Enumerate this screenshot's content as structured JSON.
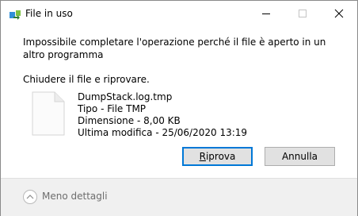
{
  "window": {
    "title": "File in uso",
    "title_icon": "file-transfer-icon",
    "controls": {
      "minimize_icon": "minimize-icon",
      "maximize_icon": "maximize-icon",
      "close_icon": "close-icon"
    }
  },
  "message": {
    "text": "Impossibile completare l'operazione perché il file è aperto in un altro programma",
    "instruction": "Chiudere il file e riprovare."
  },
  "file": {
    "icon": "generic-file-icon",
    "name": "DumpStack.log.tmp",
    "type": "Tipo - File TMP",
    "size": "Dimensione - 8,00 KB",
    "modified": "Ultima modifica - 25/06/2020 13:19"
  },
  "buttons": {
    "retry_mnemonic": "R",
    "retry_rest": "iprova",
    "cancel": "Annulla"
  },
  "footer": {
    "details_icon": "chevron-up-circle-icon",
    "details_label": "Meno dettagli"
  },
  "colors": {
    "focus_border": "#0078d7",
    "footer_bg": "#f0f0f0",
    "button_bg": "#e1e1e1"
  }
}
